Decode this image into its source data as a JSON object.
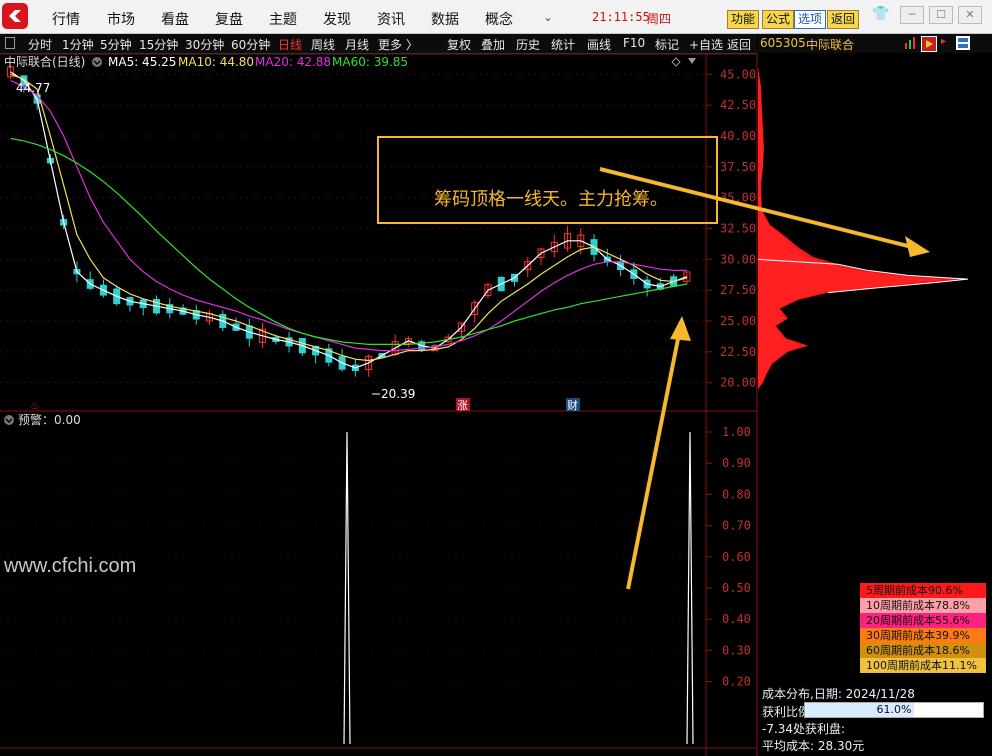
{
  "menu": {
    "items": [
      "行情",
      "市场",
      "看盘",
      "复盘",
      "主题",
      "发现",
      "资讯",
      "数据",
      "概念"
    ],
    "time": "21:11:55",
    "weekday": "周四",
    "quick_buttons": [
      "功能",
      "公式",
      "选项",
      "返回"
    ]
  },
  "toolbar": {
    "periods": [
      "分时",
      "1分钟",
      "5分钟",
      "15分钟",
      "30分钟",
      "60分钟",
      "日线",
      "周线",
      "月线",
      "更多"
    ],
    "active_period": "日线",
    "tools": [
      "复权",
      "叠加",
      "历史",
      "统计",
      "画线",
      "F10",
      "标记",
      "+自选",
      "返回"
    ]
  },
  "stock": {
    "code": "605305",
    "name": "中际联合"
  },
  "main_chart": {
    "title": "中际联合(日线)",
    "ma": [
      {
        "label": "MA5: 45.25",
        "color": "#ffffff"
      },
      {
        "label": "MA10: 44.80",
        "color": "#f0e060"
      },
      {
        "label": "MA20: 42.88",
        "color": "#e030e0"
      },
      {
        "label": "MA60: 39.85",
        "color": "#30e030"
      }
    ],
    "high_label": "44.77",
    "low_label": "20.39",
    "marker_zhang": "涨",
    "marker_cai": "财",
    "annotation": "筹码顶格一线天。主力抢筹。"
  },
  "chart_data": [
    {
      "type": "candlestick",
      "title": "中际联合(日线)",
      "ylim": [
        19,
        46
      ],
      "yticks": [
        "45.00",
        "42.50",
        "40.00",
        "37.50",
        "35.00",
        "32.50",
        "30.00",
        "27.50",
        "25.00",
        "22.50",
        "20.00"
      ],
      "series": [
        {
          "name": "MA5",
          "values": [
            45.2,
            44.5,
            43,
            38,
            33,
            29,
            28,
            27.5,
            27,
            26.6,
            26.4,
            26.2,
            26,
            25.8,
            25.5,
            25.3,
            25,
            24.5,
            24.1,
            23.8,
            23.5,
            23.3,
            23,
            22.6,
            22.2,
            21.6,
            21.2,
            21.6,
            22.2,
            22.8,
            23.4,
            23,
            22.8,
            23.5,
            24.5,
            26,
            27.5,
            28,
            28.5,
            29.5,
            30.5,
            31,
            31.5,
            31.5,
            31,
            30,
            29.5,
            28.8,
            28,
            27.8,
            28.2,
            28.6
          ]
        },
        {
          "name": "MA10",
          "values": [
            45,
            44.6,
            43.8,
            40,
            36,
            32,
            30,
            28.5,
            27.8,
            27.2,
            26.8,
            26.5,
            26.2,
            26,
            25.8,
            25.6,
            25.3,
            25,
            24.6,
            24.2,
            23.8,
            23.5,
            23.2,
            22.9,
            22.6,
            22.2,
            21.9,
            21.8,
            22,
            22.3,
            22.6,
            22.6,
            22.7,
            22.9,
            23.5,
            24.4,
            25.6,
            26.6,
            27.3,
            28,
            28.8,
            29.5,
            30.2,
            30.8,
            31,
            30.5,
            30,
            29.5,
            28.8,
            28.3,
            28.2,
            28.5
          ]
        },
        {
          "name": "MA20",
          "values": [
            44.5,
            44,
            43.3,
            42,
            40,
            37.5,
            35,
            33,
            31.5,
            30,
            29,
            28.2,
            27.6,
            27.1,
            26.7,
            26.4,
            26.1,
            25.8,
            25.4,
            25.1,
            24.7,
            24.3,
            24,
            23.7,
            23.4,
            23.1,
            22.8,
            22.7,
            22.6,
            22.6,
            22.7,
            22.8,
            22.9,
            23.1,
            23.4,
            23.8,
            24.3,
            25,
            25.8,
            26.6,
            27.4,
            28.1,
            28.7,
            29.2,
            29.6,
            29.8,
            29.8,
            29.6,
            29.4,
            29.2,
            29.1,
            29.1
          ]
        },
        {
          "name": "MA60",
          "values": [
            39.8,
            39.6,
            39.3,
            38.9,
            38.4,
            37.8,
            37.1,
            36.3,
            35.4,
            34.4,
            33.4,
            32.3,
            31.3,
            30.3,
            29.3,
            28.4,
            27.6,
            26.8,
            26.1,
            25.5,
            24.9,
            24.4,
            24,
            23.7,
            23.5,
            23.3,
            23.2,
            23.1,
            23.1,
            23.1,
            23.1,
            23.2,
            23.3,
            23.5,
            23.7,
            24,
            24.3,
            24.6,
            25,
            25.3,
            25.6,
            25.9,
            26.1,
            26.4,
            26.6,
            26.8,
            27,
            27.2,
            27.4,
            27.6,
            27.8,
            28
          ]
        }
      ]
    },
    {
      "type": "line",
      "title": "预警",
      "value_label": "预警：0.00",
      "ylim": [
        0,
        1
      ],
      "yticks": [
        "1.00",
        "0.90",
        "0.80",
        "0.70",
        "0.60",
        "0.50",
        "0.40",
        "0.30",
        "0.20"
      ],
      "signals": [
        {
          "position": 0.49,
          "value": 1.0
        },
        {
          "position": 0.98,
          "value": 1.0
        }
      ]
    },
    {
      "type": "bar",
      "title": "成本分布",
      "orientation": "horizontal",
      "ylim": [
        19,
        46
      ],
      "categories": [
        "5周期前成本90.6%",
        "10周期前成本78.8%",
        "20周期前成本55.6%",
        "30周期前成本39.9%",
        "60周期前成本18.6%",
        "100周期前成本11.1%"
      ]
    }
  ],
  "cost_panel": {
    "legend": [
      {
        "label": "5周期前成本90.6%",
        "color": "#ff1a1a"
      },
      {
        "label": "10周期前成本78.8%",
        "color": "#ffa0a8"
      },
      {
        "label": "20周期前成本55.6%",
        "color": "#ff2080"
      },
      {
        "label": "30周期前成本39.9%",
        "color": "#ff7a10"
      },
      {
        "label": "60周期前成本18.6%",
        "color": "#d09010"
      },
      {
        "label": "100周期前成本11.1%",
        "color": "#f0c040"
      }
    ],
    "date_label": "成本分布,日期: 2024/11/28",
    "profit_label": "获利比例:",
    "profit_value": "61.0%",
    "profit_ratio": 0.61,
    "profit_line": "-7.34处获利盘:",
    "avg_cost": "平均成本: 28.30元"
  },
  "watermark": "www.cfchi.com",
  "colors": {
    "up": "#ff3030",
    "down": "#30d0d0",
    "accent": "#f5b82e",
    "menu_bg": "#f2f2f2",
    "panel_bg": "#000000"
  }
}
